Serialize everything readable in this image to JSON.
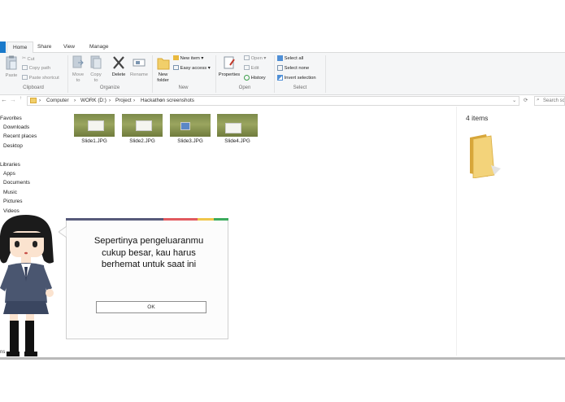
{
  "ribbon": {
    "tabs": [
      {
        "label": "Home",
        "active": true
      },
      {
        "label": "Share",
        "active": false
      },
      {
        "label": "View",
        "active": false
      },
      {
        "label": "Manage",
        "active": false
      }
    ],
    "clipboard": {
      "paste": "Paste",
      "cut": "Cut",
      "copy_path": "Copy path",
      "paste_shortcut": "Paste shortcut",
      "group_label": "Clipboard"
    },
    "organize": {
      "move_to": "Move to",
      "copy_to": "Copy to",
      "delete": "Delete",
      "rename": "Rename",
      "group_label": "Organize"
    },
    "new": {
      "new_folder": "New folder",
      "new_item": "New item",
      "easy_access": "Easy access",
      "group_label": "New"
    },
    "open": {
      "properties": "Properties",
      "open": "Open",
      "edit": "Edit",
      "history": "History",
      "group_label": "Open"
    },
    "select": {
      "select_all": "Select all",
      "select_none": "Select none",
      "invert_selection": "Invert selection",
      "group_label": "Select"
    }
  },
  "address": {
    "crumbs": [
      "Computer",
      "WORK (D:)",
      "Project",
      "Hackathon",
      "screenshots"
    ],
    "search_placeholder": "Search scr..."
  },
  "nav": {
    "favorites_header": "Favorites",
    "favorites": [
      "Downloads",
      "Recent places",
      "Desktop"
    ],
    "libraries_header": "Libraries",
    "libraries": [
      "Apps",
      "Documents",
      "Music",
      "Pictures",
      "Videos"
    ]
  },
  "files": [
    {
      "name": "Slide1.JPG"
    },
    {
      "name": "Slide2.JPG"
    },
    {
      "name": "Slide3.JPG"
    },
    {
      "name": "Slide4.JPG"
    }
  ],
  "details": {
    "item_count": "4 items"
  },
  "dialog": {
    "message": "Sepertinya pengeluaranmu cukup besar, kau harus berhemat untuk saat ini",
    "ok_label": "OK"
  },
  "colors": {
    "file_tab": "#1979ca",
    "strip": [
      "#565a7a",
      "#e15a5f",
      "#f0c64a",
      "#3cab5d"
    ]
  }
}
